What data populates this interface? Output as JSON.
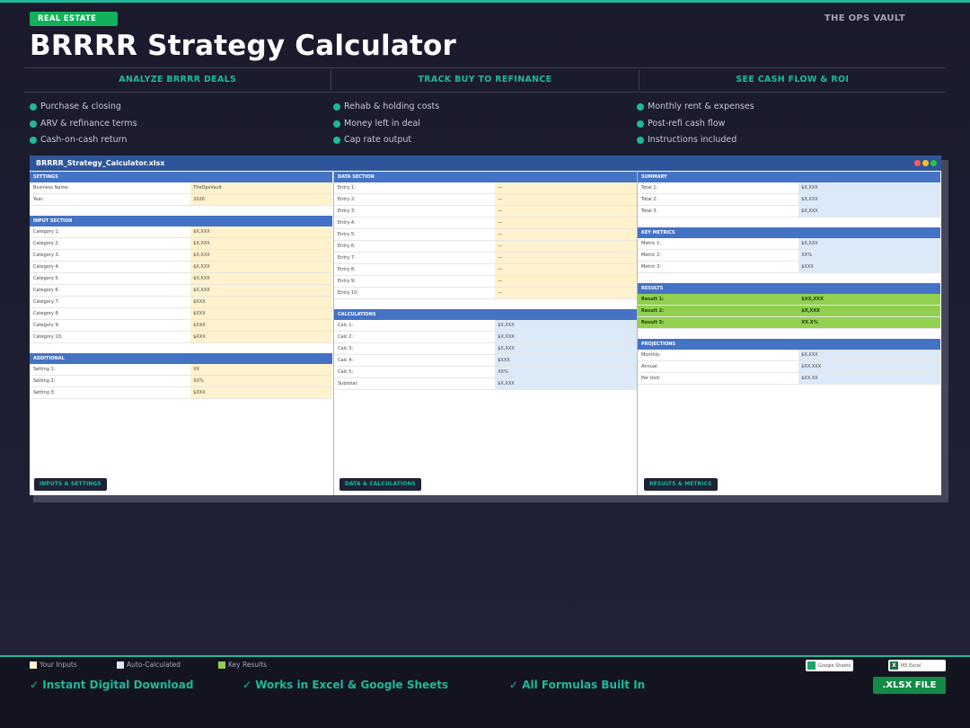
{
  "header": {
    "badge": "REAL ESTATE",
    "brand": "THE OPS VAULT",
    "title": "BRRRR Strategy Calculator"
  },
  "features": [
    "ANALYZE BRRRR DEALS",
    "TRACK BUY TO REFINANCE",
    "SEE CASH FLOW & ROI"
  ],
  "bullets": [
    [
      "Purchase & closing",
      "ARV & refinance terms",
      "Cash-on-cash return"
    ],
    [
      "Rehab & holding costs",
      "Money left in deal",
      "Cap rate output"
    ],
    [
      "Monthly rent & expenses",
      "Post-refi cash flow",
      "Instructions included"
    ]
  ],
  "colors": {
    "accent": "#1fb89a",
    "header_blue": "#4472c4",
    "input_cell": "#fff2cc",
    "auto_cell": "#dce9f8",
    "result_cell": "#92d050",
    "badge_green": "#12b05a"
  },
  "spreadsheet": {
    "filename": "BRRRR_Strategy_Calculator.xlsx",
    "settings": {
      "header": "SETTINGS",
      "rows": [
        [
          "Business Name:",
          "TheOpsVault"
        ],
        [
          "Year:",
          "2026"
        ]
      ]
    },
    "input_section": {
      "header": "INPUT SECTION",
      "rows": [
        [
          "Category 1:",
          "$X,XXX"
        ],
        [
          "Category 2:",
          "$X,XXX"
        ],
        [
          "Category 3:",
          "$X,XXX"
        ],
        [
          "Category 4:",
          "$X,XXX"
        ],
        [
          "Category 5:",
          "$X,XXX"
        ],
        [
          "Category 6:",
          "$X,XXX"
        ],
        [
          "Category 7:",
          "$XXX"
        ],
        [
          "Category 8:",
          "$XXX"
        ],
        [
          "Category 9:",
          "$XXX"
        ],
        [
          "Category 10:",
          "$XXX"
        ]
      ]
    },
    "additional": {
      "header": "ADDITIONAL",
      "rows": [
        [
          "Setting 1:",
          "XX"
        ],
        [
          "Setting 2:",
          "XX%"
        ],
        [
          "Setting 3:",
          "$XXX"
        ]
      ]
    },
    "data_section": {
      "header": "DATA SECTION",
      "rows": [
        [
          "Entry 1:",
          "—"
        ],
        [
          "Entry 2:",
          "—"
        ],
        [
          "Entry 3:",
          "—"
        ],
        [
          "Entry 4:",
          "—"
        ],
        [
          "Entry 5:",
          "—"
        ],
        [
          "Entry 6:",
          "—"
        ],
        [
          "Entry 7:",
          "—"
        ],
        [
          "Entry 8:",
          "—"
        ],
        [
          "Entry 9:",
          "—"
        ],
        [
          "Entry 10:",
          "—"
        ]
      ]
    },
    "calculations": {
      "header": "CALCULATIONS",
      "rows": [
        [
          "Calc 1:",
          "$X,XXX"
        ],
        [
          "Calc 2:",
          "$X,XXX"
        ],
        [
          "Calc 3:",
          "$X,XXX"
        ],
        [
          "Calc 4:",
          "$XXX"
        ],
        [
          "Calc 5:",
          "XX%"
        ],
        [
          "Subtotal:",
          "$X,XXX"
        ]
      ]
    },
    "summary": {
      "header": "SUMMARY",
      "rows": [
        [
          "Total 1:",
          "$X,XXX"
        ],
        [
          "Total 2:",
          "$X,XXX"
        ],
        [
          "Total 3:",
          "$X,XXX"
        ]
      ]
    },
    "key_metrics": {
      "header": "KEY METRICS",
      "rows": [
        [
          "Metric 1:",
          "$X,XXX"
        ],
        [
          "Metric 2:",
          "XX%"
        ],
        [
          "Metric 3:",
          "$XXX"
        ]
      ]
    },
    "results": {
      "header": "RESULTS",
      "rows": [
        [
          "Result 1:",
          "$XX,XXX"
        ],
        [
          "Result 2:",
          "$X,XXX"
        ],
        [
          "Result 3:",
          "XX.X%"
        ]
      ]
    },
    "projections": {
      "header": "PROJECTIONS",
      "rows": [
        [
          "Monthly:",
          "$X,XXX"
        ],
        [
          "Annual:",
          "$XX,XXX"
        ],
        [
          "Per Unit:",
          "$XX.XX"
        ]
      ]
    },
    "tabs": [
      "INPUTS & SETTINGS",
      "DATA & CALCULATIONS",
      "RESULTS & METRICS"
    ]
  },
  "legend": [
    "Your Inputs",
    "Auto-Calculated",
    "Key Results"
  ],
  "bottom_features": [
    "✓ Instant Digital Download",
    "✓ Works in Excel & Google Sheets",
    "✓ All Formulas Built In"
  ],
  "apps": {
    "google": "Google Sheets",
    "excel": "MS Excel",
    "excel_icon": "X"
  },
  "file_button": ".XLSX FILE"
}
